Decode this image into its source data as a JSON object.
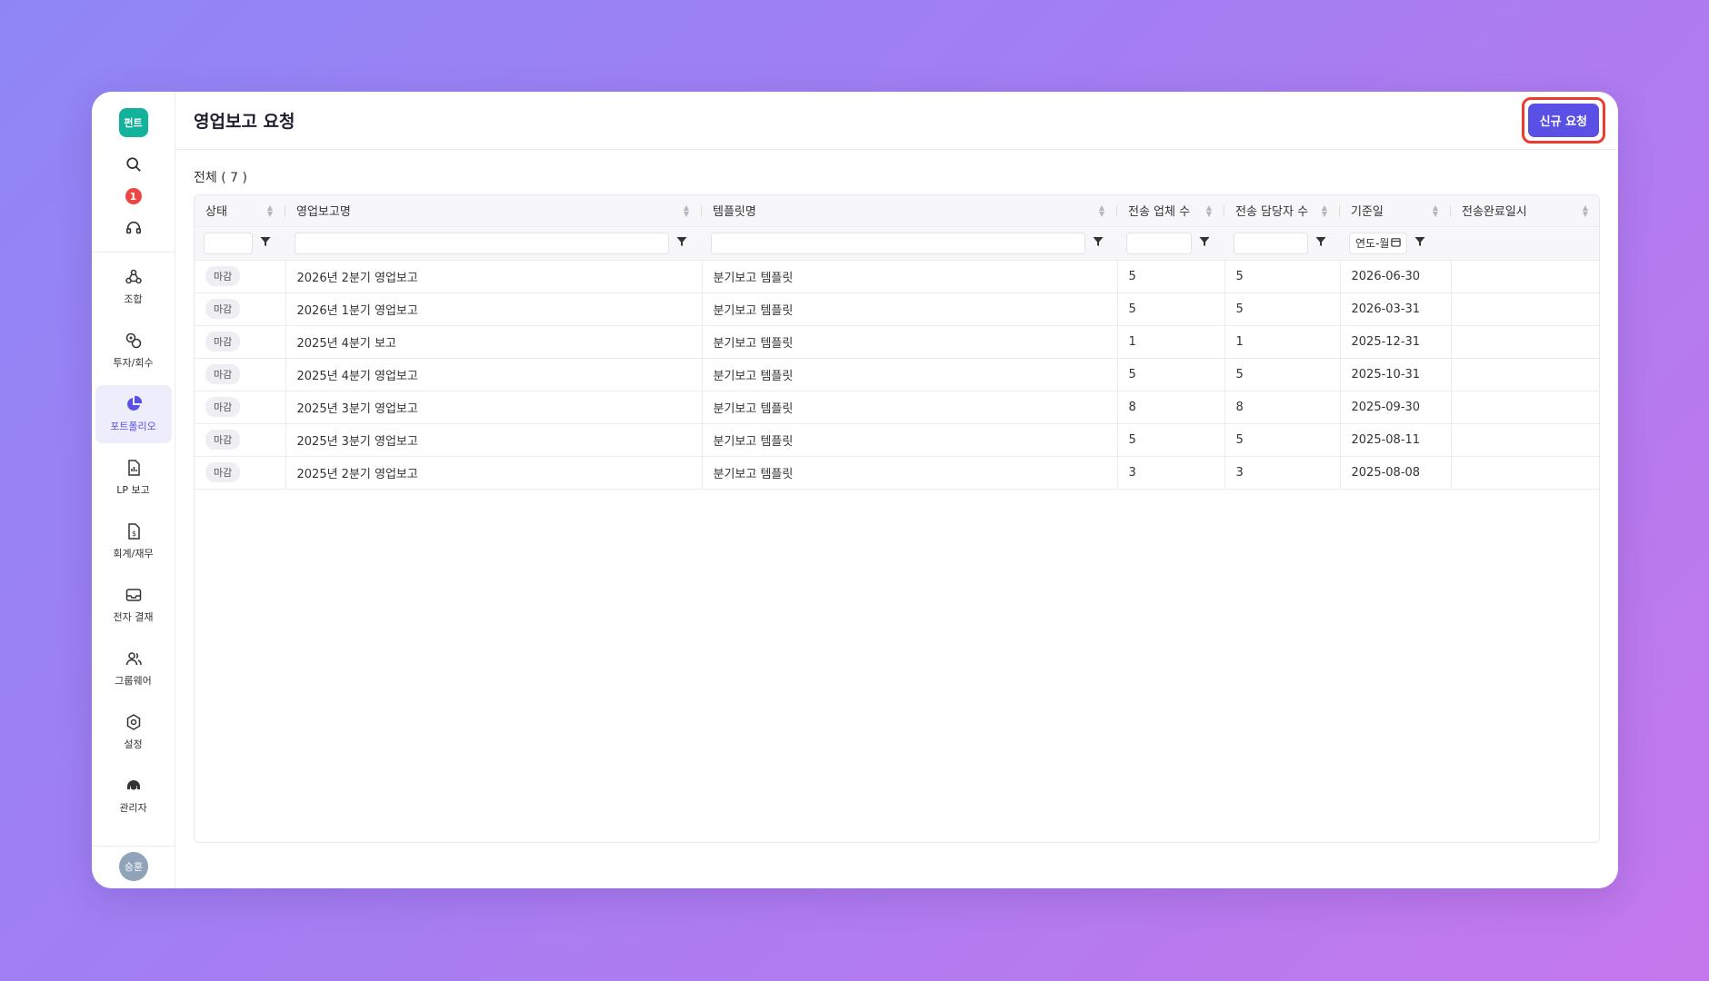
{
  "sidebar": {
    "logo_text": "펀트",
    "notification_count": "1",
    "items": [
      {
        "label": "조합",
        "icon": "union-icon"
      },
      {
        "label": "투자/회수",
        "icon": "investment-icon"
      },
      {
        "label": "포트폴리오",
        "icon": "pie-chart-icon",
        "active": true
      },
      {
        "label": "LP 보고",
        "icon": "report-file-icon"
      },
      {
        "label": "회계/재무",
        "icon": "finance-file-icon"
      },
      {
        "label": "전자 결재",
        "icon": "inbox-icon"
      },
      {
        "label": "그룹웨어",
        "icon": "users-icon"
      },
      {
        "label": "설정",
        "icon": "gear-icon"
      },
      {
        "label": "관리자",
        "icon": "admin-icon"
      }
    ],
    "avatar_text": "승훈"
  },
  "header": {
    "title": "영업보고 요청",
    "new_request_label": "신규 요청"
  },
  "list": {
    "count_label": "전체 ( 7 )",
    "columns": [
      "상태",
      "영업보고명",
      "템플릿명",
      "전송 업체 수",
      "전송 담당자 수",
      "기준일",
      "전송완료일시"
    ],
    "date_filter_placeholder": "연도-월",
    "rows": [
      {
        "status": "마감",
        "name": "2026년 2분기 영업보고",
        "template": "분기보고 템플릿",
        "companies": "5",
        "managers": "5",
        "base_date": "2026-06-30",
        "completed_at": ""
      },
      {
        "status": "마감",
        "name": "2026년 1분기 영업보고",
        "template": "분기보고 템플릿",
        "companies": "5",
        "managers": "5",
        "base_date": "2026-03-31",
        "completed_at": ""
      },
      {
        "status": "마감",
        "name": "2025년 4분기 보고",
        "template": "분기보고 템플릿",
        "companies": "1",
        "managers": "1",
        "base_date": "2025-12-31",
        "completed_at": ""
      },
      {
        "status": "마감",
        "name": "2025년 4분기 영업보고",
        "template": "분기보고 템플릿",
        "companies": "5",
        "managers": "5",
        "base_date": "2025-10-31",
        "completed_at": ""
      },
      {
        "status": "마감",
        "name": "2025년 3분기 영업보고",
        "template": "분기보고 템플릿",
        "companies": "8",
        "managers": "8",
        "base_date": "2025-09-30",
        "completed_at": ""
      },
      {
        "status": "마감",
        "name": "2025년 3분기 영업보고",
        "template": "분기보고 템플릿",
        "companies": "5",
        "managers": "5",
        "base_date": "2025-08-11",
        "completed_at": ""
      },
      {
        "status": "마감",
        "name": "2025년 2분기 영업보고",
        "template": "분기보고 템플릿",
        "companies": "3",
        "managers": "3",
        "base_date": "2025-08-08",
        "completed_at": ""
      }
    ]
  },
  "colors": {
    "accent": "#5a50e6",
    "logo": "#13b39b",
    "badge": "#ef4444",
    "highlight_border": "#ef3b2f"
  }
}
